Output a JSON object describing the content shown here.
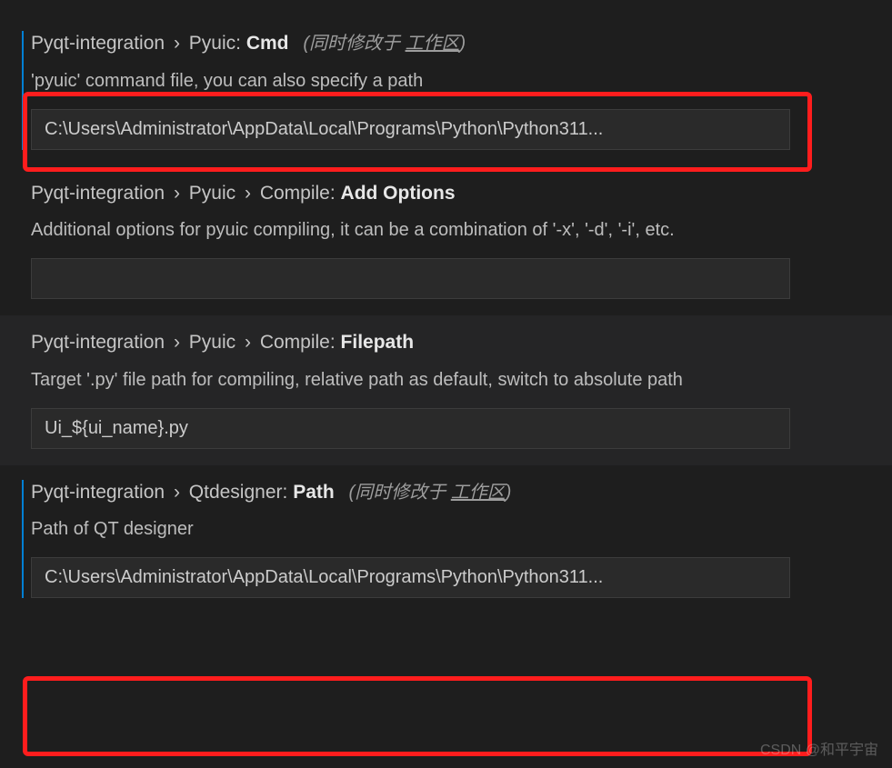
{
  "settings": {
    "pyuic_cmd": {
      "breadcrumb1": "Pyqt-integration",
      "breadcrumb2": "Pyuic",
      "label": "Cmd",
      "scope_prefix": "(同时修改于 ",
      "scope_link": "工作区",
      "scope_suffix": ")",
      "description": "'pyuic' command file, you can also specify a path",
      "value": "C:\\Users\\Administrator\\AppData\\Local\\Programs\\Python\\Python311..."
    },
    "pyuic_add_options": {
      "breadcrumb1": "Pyqt-integration",
      "breadcrumb2": "Pyuic",
      "breadcrumb3": "Compile",
      "label": "Add Options",
      "description": "Additional options for pyuic compiling, it can be a combination of '-x', '-d', '-i', etc.",
      "value": ""
    },
    "pyuic_filepath": {
      "breadcrumb1": "Pyqt-integration",
      "breadcrumb2": "Pyuic",
      "breadcrumb3": "Compile",
      "label": "Filepath",
      "description": "Target '.py' file path for compiling, relative path as default, switch to absolute path",
      "value": "Ui_${ui_name}.py"
    },
    "qtdesigner_path": {
      "breadcrumb1": "Pyqt-integration",
      "breadcrumb2": "Qtdesigner",
      "label": "Path",
      "scope_prefix": "(同时修改于 ",
      "scope_link": "工作区",
      "scope_suffix": ")",
      "description": "Path of QT designer",
      "value": "C:\\Users\\Administrator\\AppData\\Local\\Programs\\Python\\Python311..."
    }
  },
  "watermark": "CSDN @和平宇宙"
}
